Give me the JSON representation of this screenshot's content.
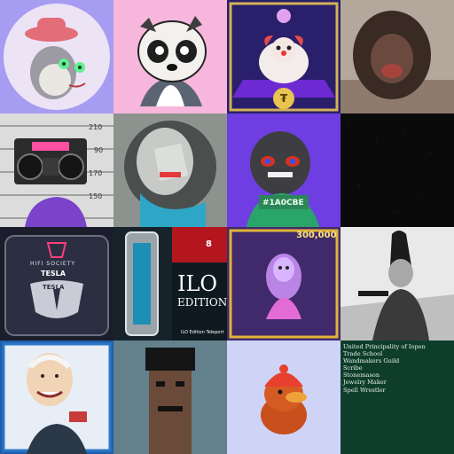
{
  "tiles": {
    "t3": {
      "label": "₮"
    },
    "t6": {
      "tag": "#1A0CBE"
    },
    "t8": {
      "brand": "HIFI SOCIETY",
      "name": "TESLA",
      "badge": "TESLA"
    },
    "t9": {
      "number": "8",
      "title_line1": "ILO",
      "title_line2": "EDITION",
      "caption": "ILO Edition Teleport"
    },
    "t10": {
      "price": "300,000"
    },
    "t15": {
      "items": [
        "United Principality of Iopen",
        "Trade School",
        "Wandmakers Guild",
        "Scribe",
        "Stonemason",
        "Jewelry Maker",
        "Spell Wrestler"
      ]
    }
  },
  "colors": {
    "list_bg": "#0f3d2c",
    "list_text": "#e6efe9"
  }
}
